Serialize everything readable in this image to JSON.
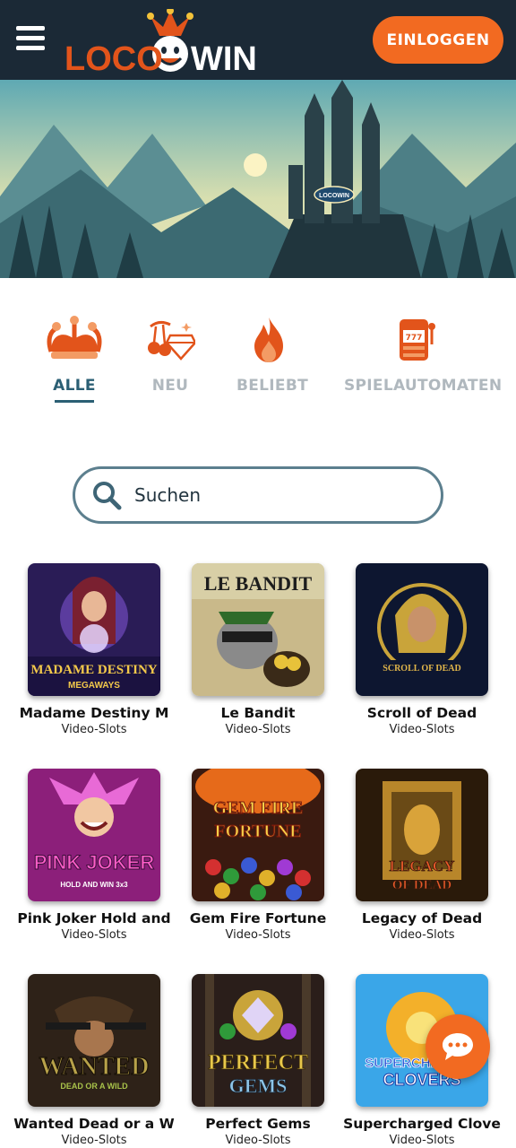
{
  "header": {
    "brand": "LOCOWIN",
    "brand_part1": "LOCO",
    "brand_part2": "WIN",
    "login_label": "EINLOGGEN"
  },
  "hero": {
    "sign_text": "LOCOWIN"
  },
  "categories": [
    {
      "label": "ALLE",
      "icon": "jester-hat-icon",
      "active": true
    },
    {
      "label": "NEU",
      "icon": "cherry-diamond-icon",
      "active": false
    },
    {
      "label": "BELIEBT",
      "icon": "flame-icon",
      "active": false
    },
    {
      "label": "SPIELAUTOMATEN",
      "icon": "slot-machine-icon",
      "active": false
    }
  ],
  "search": {
    "placeholder": "Suchen"
  },
  "games": [
    {
      "title": "Madame Destiny M",
      "category": "Video-Slots",
      "art_text": "MADAME DESTINY",
      "art_sub": "MEGAWAYS"
    },
    {
      "title": "Le Bandit",
      "category": "Video-Slots",
      "art_text": "LE BANDIT",
      "art_sub": ""
    },
    {
      "title": "Scroll of Dead",
      "category": "Video-Slots",
      "art_text": "SCROLL OF DEAD",
      "art_sub": ""
    },
    {
      "title": "Pink Joker Hold and",
      "category": "Video-Slots",
      "art_text": "PINK JOKER",
      "art_sub": "HOLD AND WIN 3x3"
    },
    {
      "title": "Gem Fire Fortune",
      "category": "Video-Slots",
      "art_text": "GEM FIRE",
      "art_sub": "FORTUNE"
    },
    {
      "title": "Legacy of Dead",
      "category": "Video-Slots",
      "art_text": "LEGACY",
      "art_sub": "OF DEAD"
    },
    {
      "title": "Wanted Dead or a W",
      "category": "Video-Slots",
      "art_text": "WANTED",
      "art_sub": "DEAD OR A WILD"
    },
    {
      "title": "Perfect Gems",
      "category": "Video-Slots",
      "art_text": "PERFECT",
      "art_sub": "GEMS"
    },
    {
      "title": "Supercharged Clove",
      "category": "Video-Slots",
      "art_text": "SUPERCHARGED",
      "art_sub": "CLOVERS"
    }
  ],
  "colors": {
    "header_bg": "#1b2936",
    "accent": "#f26a21",
    "active_tab": "#2b5f74",
    "inactive_tab": "#b0b8be"
  }
}
